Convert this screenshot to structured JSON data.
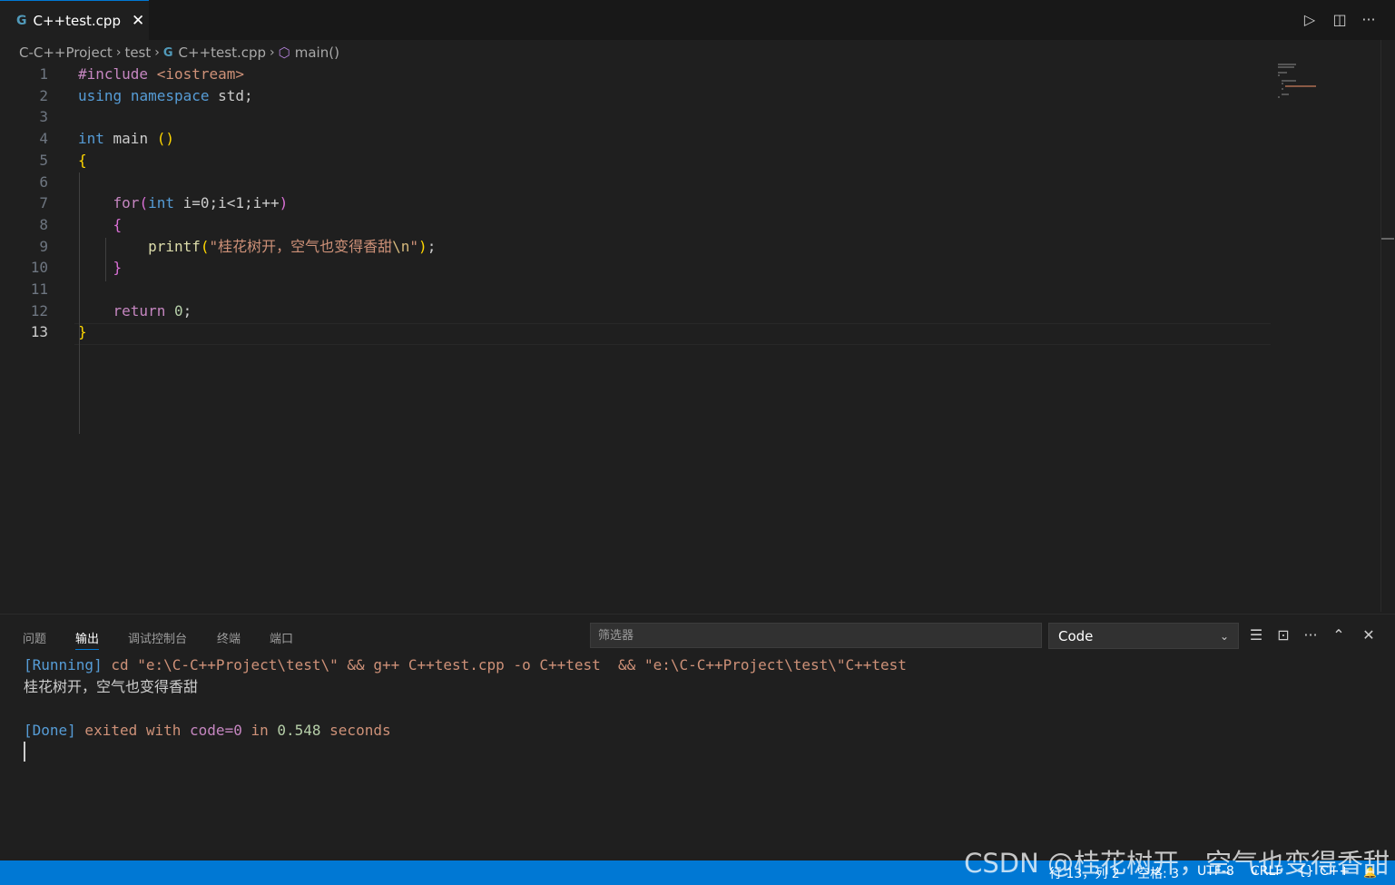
{
  "tab": {
    "icon": "cpp-icon",
    "label": "C++test.cpp",
    "close": "✕"
  },
  "toolbar": {
    "run": "▷",
    "split": "◫",
    "more": "···"
  },
  "breadcrumb": {
    "items": [
      "C-C++Project",
      "test",
      "C++test.cpp",
      "main()"
    ],
    "file_icon": "G",
    "symbol_icon": "⬡"
  },
  "editor": {
    "line_numbers": [
      "1",
      "2",
      "3",
      "4",
      "5",
      "6",
      "7",
      "8",
      "9",
      "10",
      "11",
      "12",
      "13"
    ],
    "current_line": 13,
    "lines": [
      [
        [
          "pp",
          "#include "
        ],
        [
          "inc",
          "<iostream>"
        ]
      ],
      [
        [
          "kw",
          "using"
        ],
        [
          "plain",
          " "
        ],
        [
          "kw",
          "namespace"
        ],
        [
          "plain",
          " std;"
        ]
      ],
      [],
      [
        [
          "kw",
          "int"
        ],
        [
          "plain",
          " main "
        ],
        [
          "b1",
          "()"
        ]
      ],
      [
        [
          "b1",
          "{"
        ]
      ],
      [],
      [
        [
          "plain",
          "    "
        ],
        [
          "pp",
          "for"
        ],
        [
          "b2",
          "("
        ],
        [
          "kw",
          "int"
        ],
        [
          "plain",
          " i=0;i<1;i++"
        ],
        [
          "b2",
          ")"
        ]
      ],
      [
        [
          "plain",
          "    "
        ],
        [
          "b2",
          "{"
        ]
      ],
      [
        [
          "plain",
          "        "
        ],
        [
          "fn",
          "printf"
        ],
        [
          "b1",
          "("
        ],
        [
          "str",
          "\"桂花树开，空气也变得香甜"
        ],
        [
          "esc",
          "\\n"
        ],
        [
          "str",
          "\""
        ],
        [
          "b1",
          ")"
        ],
        [
          "plain",
          ";"
        ]
      ],
      [
        [
          "plain",
          "    "
        ],
        [
          "b2",
          "}"
        ]
      ],
      [],
      [
        [
          "plain",
          "    "
        ],
        [
          "pp",
          "return"
        ],
        [
          "plain",
          " "
        ],
        [
          "num",
          "0"
        ],
        [
          "plain",
          ";"
        ]
      ],
      [
        [
          "b1",
          "}"
        ]
      ]
    ]
  },
  "panel": {
    "tabs": [
      "问题",
      "输出",
      "调试控制台",
      "终端",
      "端口"
    ],
    "active_tab": "输出",
    "filter_placeholder": "筛选器",
    "channel": "Code",
    "output": {
      "running_tag": "[Running]",
      "running_cmd": " cd \"e:\\C-C++Project\\test\\\" && g++ C++test.cpp -o C++test  && \"e:\\C-C++Project\\test\\\"C++test",
      "program_output": "桂花树开，空气也变得香甜",
      "done_tag": "[Done]",
      "done_exited": " exited with ",
      "done_code": "code=0",
      "done_in": " in ",
      "done_time": "0.548",
      "done_seconds": " seconds"
    }
  },
  "status": {
    "position": "行 13，列 2",
    "spaces": "空格: 3",
    "encoding": "UTF-8",
    "eol": "CRLF",
    "language_icon": "{}",
    "language": "C++",
    "bell": "🔔"
  },
  "watermark": "CSDN @桂花树开，空气也变得香甜",
  "colors": {
    "accent": "#0078d4",
    "editor_bg": "#1f1f1f",
    "tabbar_bg": "#181818"
  }
}
